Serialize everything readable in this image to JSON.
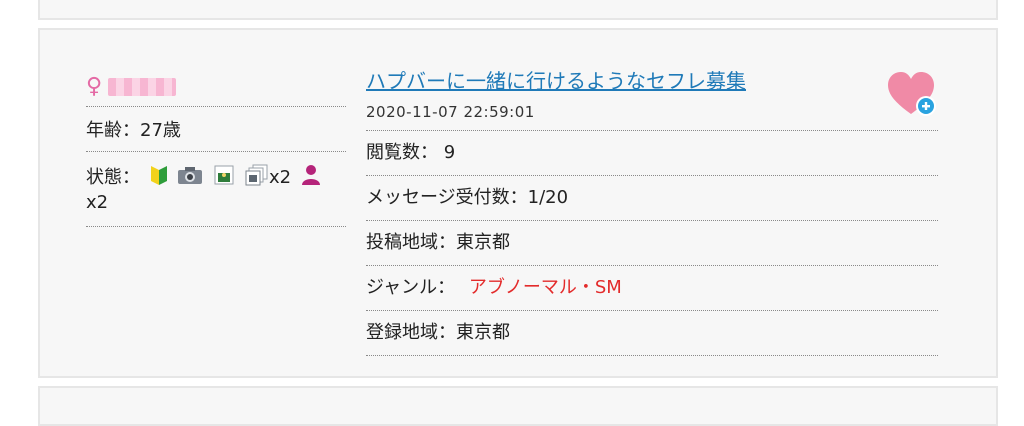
{
  "post": {
    "gender_symbol": "♀",
    "age_label": "年齢：27歳",
    "status_label": "状態：",
    "photo_count_a": "x2",
    "photo_count_b": "x2",
    "title": "ハプバーに一緒に行けるようなセフレ募集",
    "datetime": "2020-11-07 22:59:01",
    "views_label": "閲覧数：",
    "views_value": "9",
    "messages_label": "メッセージ受付数：",
    "messages_value": "1/20",
    "post_area_label": "投稿地域：",
    "post_area_value": "東京都",
    "genre_label": "ジャンル：",
    "genre_value": "アブノーマル・SM",
    "reg_area_label": "登録地域：",
    "reg_area_value": "東京都"
  },
  "icons": {
    "gender": "female-icon",
    "beginner": "beginner-mark-icon",
    "camera": "camera-icon",
    "photo": "photo-icon",
    "photos": "photos-stack-icon",
    "person": "person-icon",
    "favorite": "heart-add-icon"
  },
  "colors": {
    "link": "#1f7ab8",
    "genre": "#e32b2b",
    "heart": "#f08aa6",
    "add_badge": "#2aa3e0"
  }
}
